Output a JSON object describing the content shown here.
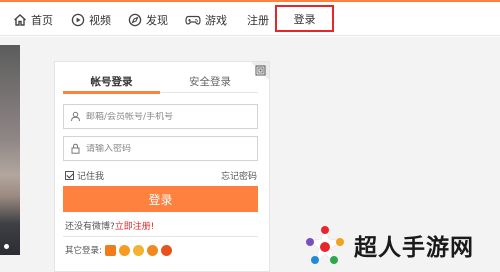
{
  "nav": {
    "home": "首页",
    "video": "视频",
    "discover": "发现",
    "game": "游戏",
    "register": "注册",
    "login": "登录"
  },
  "login_panel": {
    "tab_account": "帐号登录",
    "tab_secure": "安全登录",
    "username_placeholder": "邮箱/会员帐号/手机号",
    "password_placeholder": "请输入密码",
    "remember_label": "记住我",
    "remember_checked": true,
    "forgot_label": "忘记密码",
    "submit_label": "登录",
    "no_account_text": "还没有微博?",
    "register_link": "立即注册!",
    "other_login_label": "其它登录:"
  },
  "colors": {
    "accent": "#ff8140",
    "highlight_box": "#e8262a"
  },
  "watermark": {
    "text": "超人手游网"
  }
}
